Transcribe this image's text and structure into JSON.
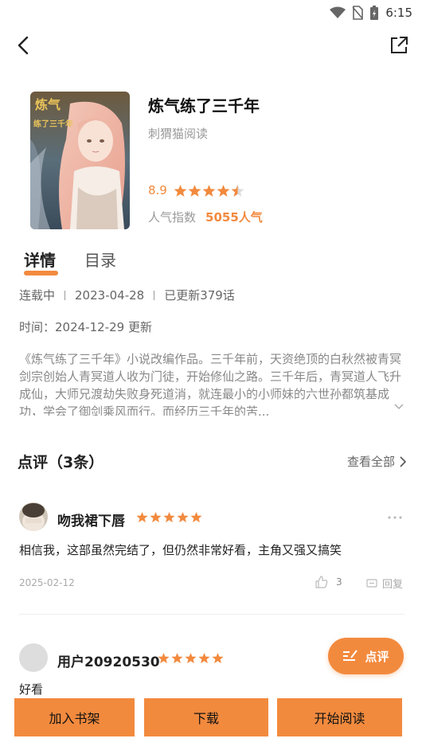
{
  "status_bar": {
    "time": "6:15"
  },
  "book": {
    "title": "炼气练了三千年",
    "author": "刺猬猫阅读",
    "rating": "8.9",
    "stars": 4.5,
    "popularity_label": "人气指数",
    "popularity_value": "5055人气",
    "cover_text": "炼气练了三千年"
  },
  "tabs": [
    {
      "label": "详情",
      "active": true
    },
    {
      "label": "目录",
      "active": false
    }
  ],
  "meta": {
    "status": "连载中",
    "date": "2023-04-28",
    "updated": "已更新379话",
    "time_line": "时间：2024-12-29 更新"
  },
  "description": "《炼气练了三千年》小说改编作品。三千年前，天资绝顶的白秋然被青冥剑宗创始人青冥道人收为门徒，开始修仙之路。三千年后，青冥道人飞升成仙，大师兄渡劫失败身死道消，就连最小的小师妹的六世孙都筑基成功，学会了御剑乘风而行。而经历三千年的苦...",
  "reviews_section": {
    "title": "点评（3条）",
    "view_all": "查看全部"
  },
  "reviews": [
    {
      "name": "吻我裙下唇",
      "stars": 5,
      "text": "相信我，这部虽然完结了，但仍然非常好看，主角又强又搞笑",
      "date": "2025-02-12",
      "likes": "3",
      "reply": "回复"
    },
    {
      "name": "用户20920530",
      "stars": 5,
      "text": "好看"
    }
  ],
  "fab": {
    "label": "点评"
  },
  "bottom_bar": {
    "add_shelf": "加入书架",
    "download": "下载",
    "start_reading": "开始阅读"
  },
  "colors": {
    "accent": "#f28a3e",
    "accent_star": "#f28a3e"
  }
}
